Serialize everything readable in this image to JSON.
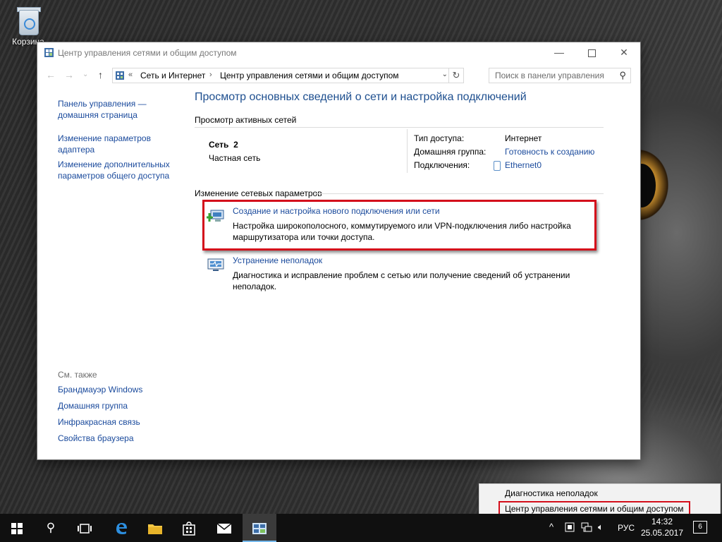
{
  "desktop": {
    "recycle_bin_label": "Корзина"
  },
  "window": {
    "title": "Центр управления сетями и общим доступом",
    "breadcrumb": [
      "Сеть и Интернет",
      "Центр управления сетями и общим доступом"
    ],
    "search_placeholder": "Поиск в панели управления"
  },
  "left_pane": {
    "links": [
      "Панель управления — домашняя страница",
      "Изменение параметров адаптера",
      "Изменение дополнительных параметров общего доступа"
    ],
    "see_also_header": "См. также",
    "see_also": [
      "Брандмауэр Windows",
      "Домашняя группа",
      "Инфракрасная связь",
      "Свойства браузера"
    ]
  },
  "main": {
    "title": "Просмотр основных сведений о сети и настройка подключений",
    "active_networks_header": "Просмотр активных сетей",
    "network": {
      "name": "Сеть  2",
      "type": "Частная сеть",
      "access_type_label": "Тип доступа:",
      "access_type_value": "Интернет",
      "homegroup_label": "Домашняя группа:",
      "homegroup_value": "Готовность к созданию",
      "connections_label": "Подключения:",
      "connections_value": "Ethernet0"
    },
    "change_settings_header": "Изменение сетевых параметров",
    "tasks": [
      {
        "link": "Создание и настройка нового подключения или сети",
        "description": "Настройка широкополосного, коммутируемого или VPN-подключения либо настройка маршрутизатора или точки доступа."
      },
      {
        "link": "Устранение неполадок",
        "description": "Диагностика и исправление проблем с сетью или получение сведений об устранении неполадок."
      }
    ]
  },
  "popup_menu": {
    "items": [
      "Диагностика неполадок",
      "Центр управления сетями и общим доступом"
    ]
  },
  "taskbar": {
    "language": "РУС",
    "time": "14:32",
    "date": "25.05.2017",
    "notification_count": "6"
  },
  "colors": {
    "link": "#1a4a9c",
    "title": "#1e4f8f",
    "highlight": "#d40e1b",
    "taskbar": "#101010"
  }
}
